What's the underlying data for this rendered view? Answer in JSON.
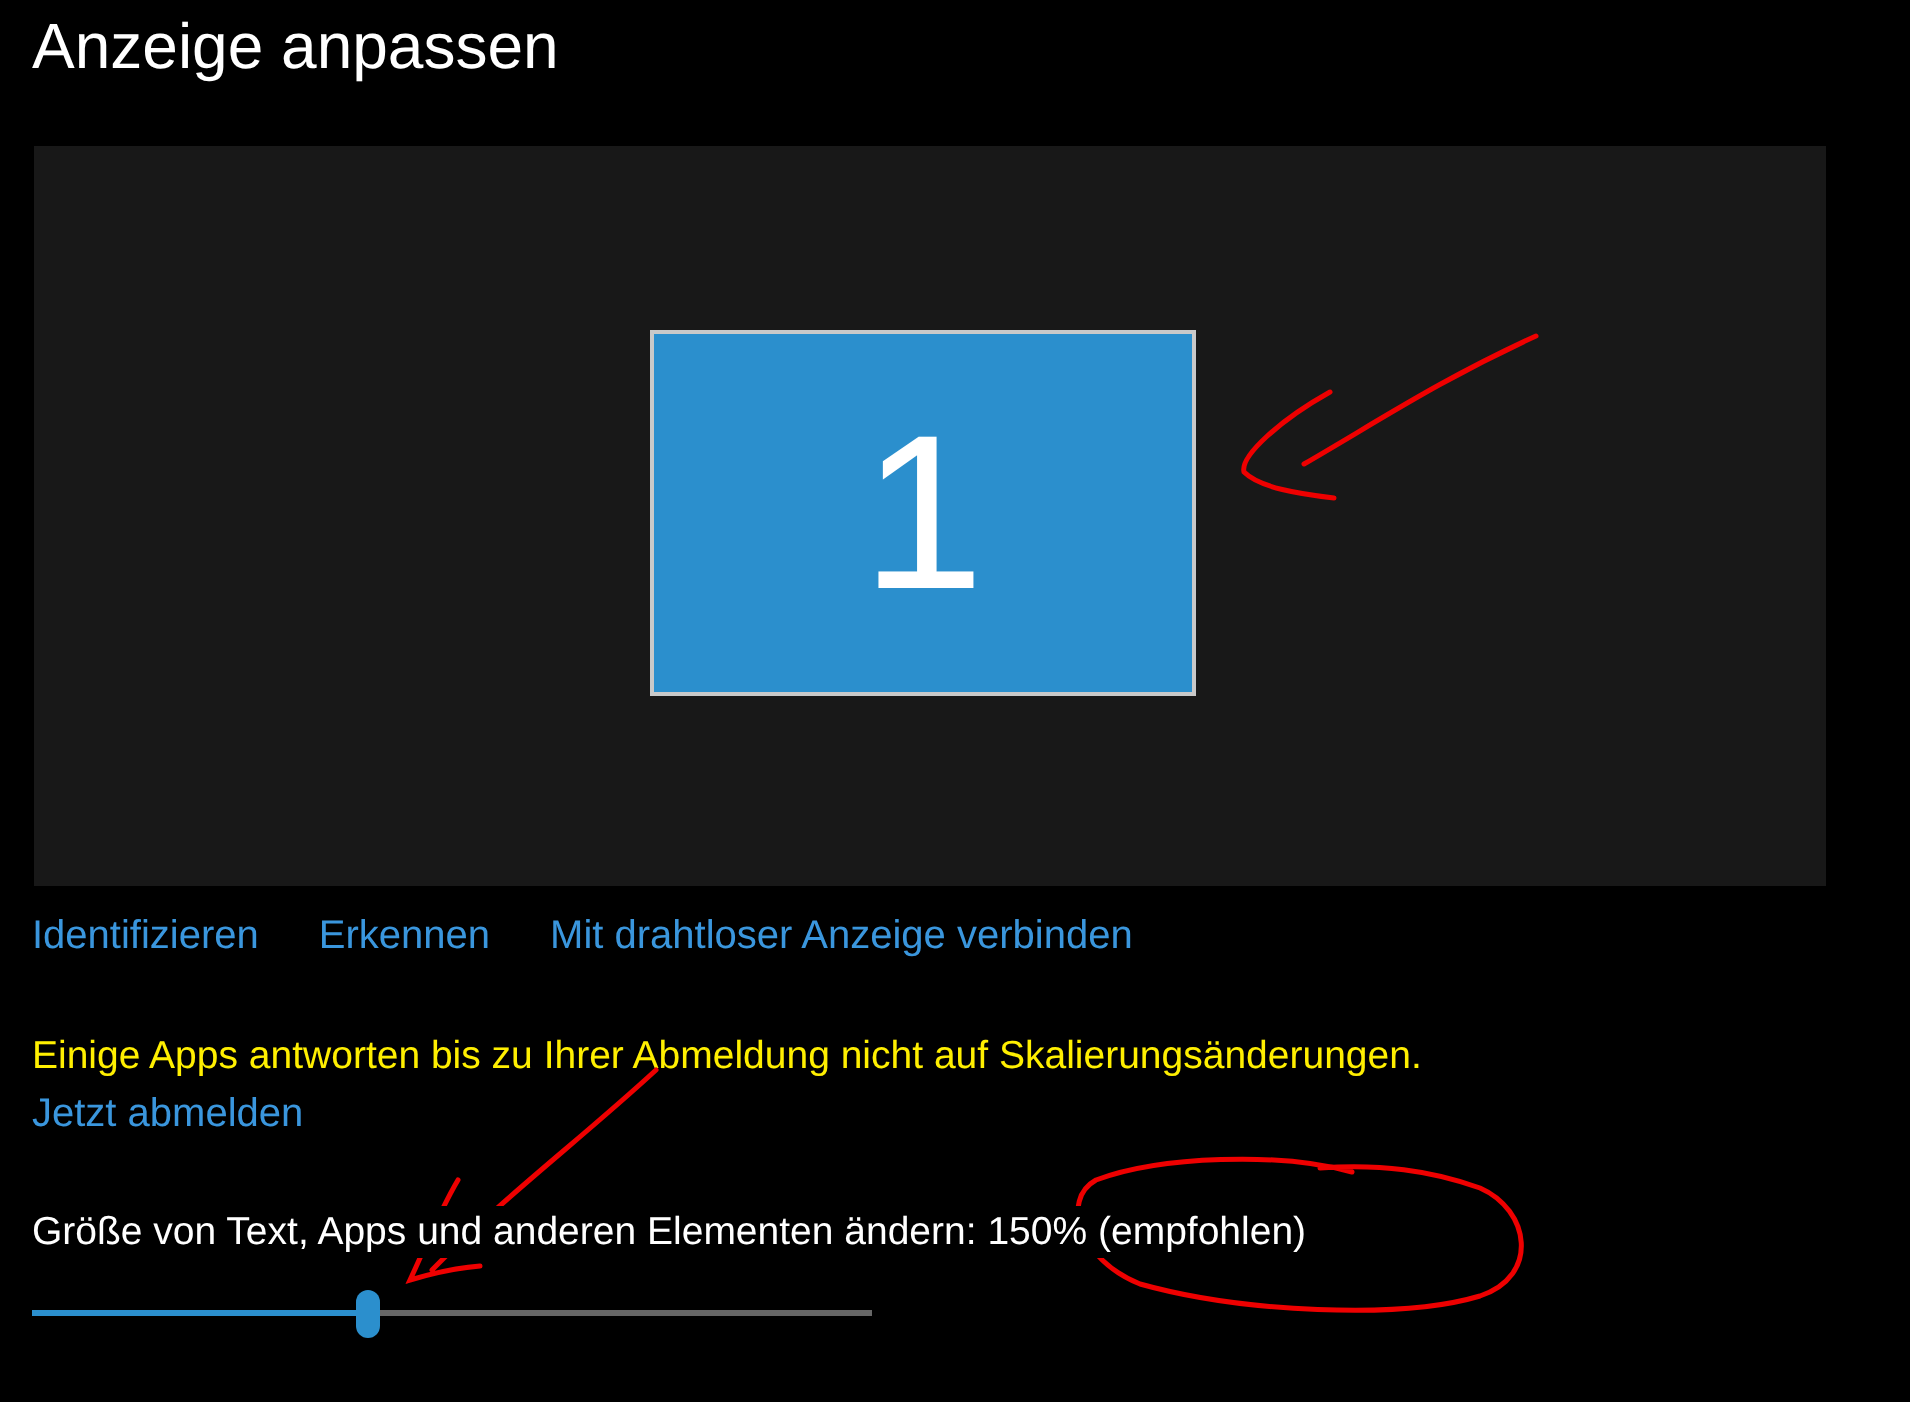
{
  "title": "Anzeige anpassen",
  "displays": [
    {
      "label": "1",
      "selected": true
    }
  ],
  "links": [
    "Identifizieren",
    "Erkennen",
    "Mit drahtloser Anzeige verbinden"
  ],
  "warning": "Einige Apps antworten bis zu Ihrer Abmeldung nicht auf Skalierungsänderungen.",
  "signout_link": "Jetzt abmelden",
  "scale": {
    "label": "Größe von Text, Apps und anderen Elementen ändern: 150% (empfohlen)",
    "level": 0.4
  }
}
